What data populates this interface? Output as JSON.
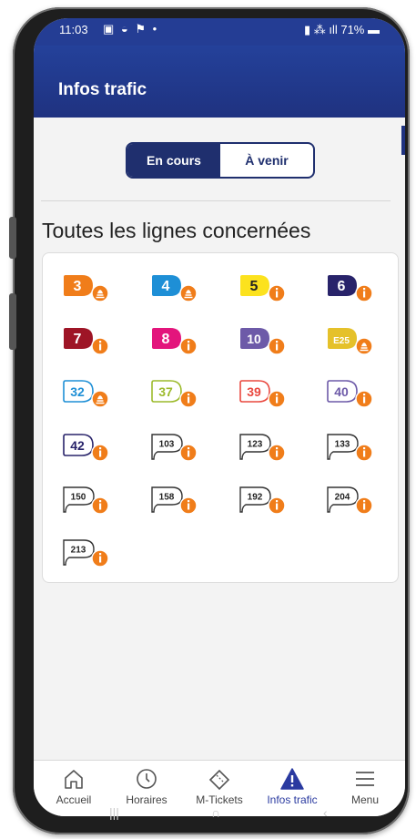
{
  "status_bar": {
    "time": "11:03",
    "battery": "71%"
  },
  "header": {
    "title": "Infos trafic"
  },
  "tabs": [
    {
      "label": "En cours",
      "active": true
    },
    {
      "label": "À venir",
      "active": false
    }
  ],
  "section_title": "Toutes les lignes concernées",
  "lines": [
    {
      "label": "3",
      "color": "#f07d1a",
      "kind": "metro",
      "alert": "works"
    },
    {
      "label": "4",
      "color": "#1e8fd6",
      "kind": "metro",
      "alert": "works"
    },
    {
      "label": "5",
      "color": "#fce21e",
      "kind": "metro",
      "alert": "info",
      "text_color": "#222"
    },
    {
      "label": "6",
      "color": "#28236a",
      "kind": "metro",
      "alert": "info"
    },
    {
      "label": "7",
      "color": "#9e1526",
      "kind": "metro",
      "alert": "info"
    },
    {
      "label": "8",
      "color": "#e3157c",
      "kind": "metro",
      "alert": "info"
    },
    {
      "label": "10",
      "color": "#6d5aa8",
      "kind": "metro",
      "alert": "info"
    },
    {
      "label": "E25",
      "color": "#e5c12a",
      "kind": "express",
      "alert": "works"
    },
    {
      "label": "32",
      "color": "#1e8fd6",
      "kind": "outline",
      "alert": "works"
    },
    {
      "label": "37",
      "color": "#9cba2b",
      "kind": "outline",
      "alert": "info"
    },
    {
      "label": "39",
      "color": "#e9483f",
      "kind": "outline",
      "alert": "info"
    },
    {
      "label": "40",
      "color": "#6d5aa8",
      "kind": "outline",
      "alert": "info"
    },
    {
      "label": "42",
      "color": "#28236a",
      "kind": "outline",
      "alert": "info"
    },
    {
      "label": "103",
      "color": "#333333",
      "kind": "bus",
      "alert": "info"
    },
    {
      "label": "123",
      "color": "#333333",
      "kind": "bus",
      "alert": "info"
    },
    {
      "label": "133",
      "color": "#333333",
      "kind": "bus",
      "alert": "info"
    },
    {
      "label": "150",
      "color": "#333333",
      "kind": "bus",
      "alert": "info"
    },
    {
      "label": "158",
      "color": "#333333",
      "kind": "bus",
      "alert": "info"
    },
    {
      "label": "192",
      "color": "#333333",
      "kind": "bus",
      "alert": "info"
    },
    {
      "label": "204",
      "color": "#333333",
      "kind": "bus",
      "alert": "info"
    },
    {
      "label": "213",
      "color": "#333333",
      "kind": "bus",
      "alert": "info"
    }
  ],
  "alert_color": "#f07d1a",
  "bottom_nav": [
    {
      "label": "Accueil",
      "icon": "home-icon"
    },
    {
      "label": "Horaires",
      "icon": "clock-icon"
    },
    {
      "label": "M-Tickets",
      "icon": "ticket-icon"
    },
    {
      "label": "Infos trafic",
      "icon": "warning-icon",
      "active": true
    },
    {
      "label": "Menu",
      "icon": "menu-icon"
    }
  ],
  "accent_color": "#1f2f6e"
}
